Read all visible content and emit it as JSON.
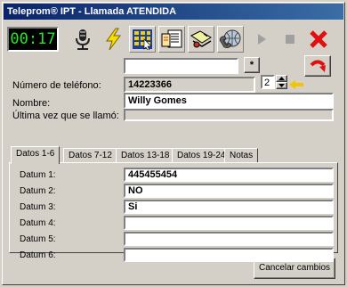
{
  "window": {
    "title": "Teleprom® IPT - Llamada ATENDIDA"
  },
  "toolbar": {
    "timer": "00:17",
    "icons": [
      "microphone-icon",
      "lightning-icon",
      "keypad-icon",
      "script-icon",
      "transfer-icon",
      "phone-network-icon",
      "play-icon",
      "stop-icon",
      "close-icon"
    ]
  },
  "top": {
    "search_value": "",
    "asterisk": "*"
  },
  "phone": {
    "label": "Número de teléfono:",
    "value": "14223366",
    "spin_value": "2"
  },
  "name": {
    "label": "Nombre:",
    "value": "Willy Gomes"
  },
  "last_call": {
    "label": "Última vez que se llamó:",
    "value": ""
  },
  "tabs": [
    "Datos 1-6",
    "Datos 7-12",
    "Datos 13-18",
    "Datos 19-24",
    "Notas"
  ],
  "data_fields": [
    {
      "label": "Datum 1:",
      "value": "445455454"
    },
    {
      "label": "Datum 2:",
      "value": "NO"
    },
    {
      "label": "Datum 3:",
      "value": "Si"
    },
    {
      "label": "Datum 4:",
      "value": ""
    },
    {
      "label": "Datum 5:",
      "value": ""
    },
    {
      "label": "Datum 6:",
      "value": ""
    }
  ],
  "cancel_label": "Cancelar cambios",
  "colors": {
    "title_bar": "#0a246a",
    "timer_text": "#29e629",
    "close_red": "#e01010",
    "arrow_yellow": "#f5c400"
  }
}
